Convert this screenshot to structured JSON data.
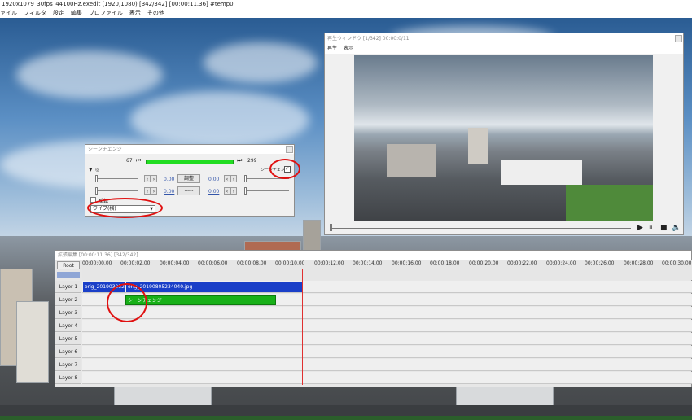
{
  "window_title": "1920x1079_30fps_44100Hz.exedit (1920,1080)  [342/342]  [00:00:11.36]  #temp0",
  "menu": [
    "ァイル",
    "フィルタ",
    "設定",
    "編集",
    "プロファイル",
    "表示",
    "その他"
  ],
  "scene_change": {
    "title": "シーンチェンジ",
    "frame_start": "67",
    "frame_end": "299",
    "checkbox_label": "シーンチェンジ",
    "value1": "0.00",
    "value2": "0.00",
    "value3": "0.00",
    "value4": "0.00",
    "adjust_label": "調整",
    "dashes": "-----",
    "invert_label": "反転",
    "effect_select": "ワイプ(横)"
  },
  "playback": {
    "title": "再生ウィンドウ [1/342]  00:00:0/11",
    "menu": [
      "再生",
      "表示"
    ]
  },
  "timeline": {
    "title": "拡張編集 [00:00:11.36]  [342/342]",
    "root": "Root",
    "ticks": [
      "00:00:00.00",
      "00:00:02.00",
      "00:00:04.00",
      "00:00:06.00",
      "00:00:08.00",
      "00:00:10.00",
      "00:00:12.00",
      "00:00:14.00",
      "00:00:16.00",
      "00:00:18.00",
      "00:00:20.00",
      "00:00:22.00",
      "00:00:24.00",
      "00:00:26.00",
      "00:00:28.00",
      "00:00:30.00"
    ],
    "layers": [
      "Layer 1",
      "Layer 2",
      "Layer 3",
      "Layer 4",
      "Layer 5",
      "Layer 6",
      "Layer 7",
      "Layer 8"
    ],
    "clip1": "orig_20190305233",
    "clip2": "orig_20190805234040.jpg",
    "clip3": "シーンチェンジ"
  },
  "colors": {
    "clip_blue": "#1a3fc8",
    "clip_green": "#18b018",
    "slider_green": "#22dd22",
    "cursor_red": "#e03030"
  }
}
